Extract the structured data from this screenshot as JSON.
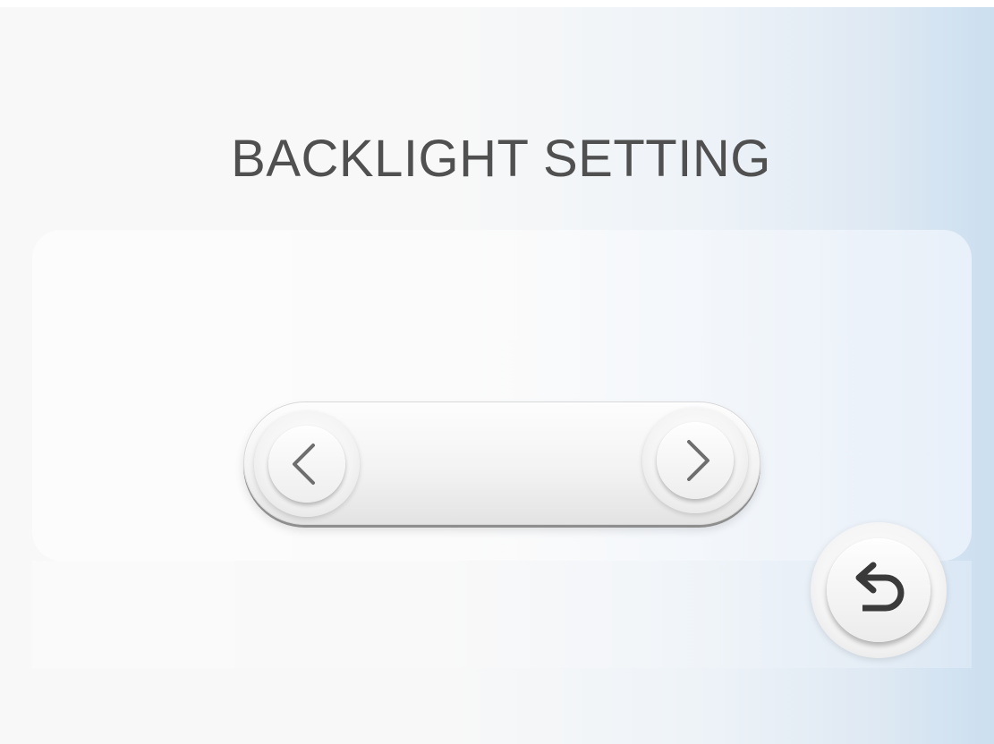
{
  "screen": {
    "title": "BACKLIGHT SETTING"
  },
  "selector": {
    "current_value": ""
  },
  "icons": {
    "previous": "chevron-left-icon",
    "next": "chevron-right-icon",
    "back": "return-arrow-icon"
  },
  "colors": {
    "title_text": "#505050",
    "background_accent": "#cbdff0",
    "icon_stroke": "#6e6e6e",
    "back_icon_stroke": "#3a3a3a"
  }
}
